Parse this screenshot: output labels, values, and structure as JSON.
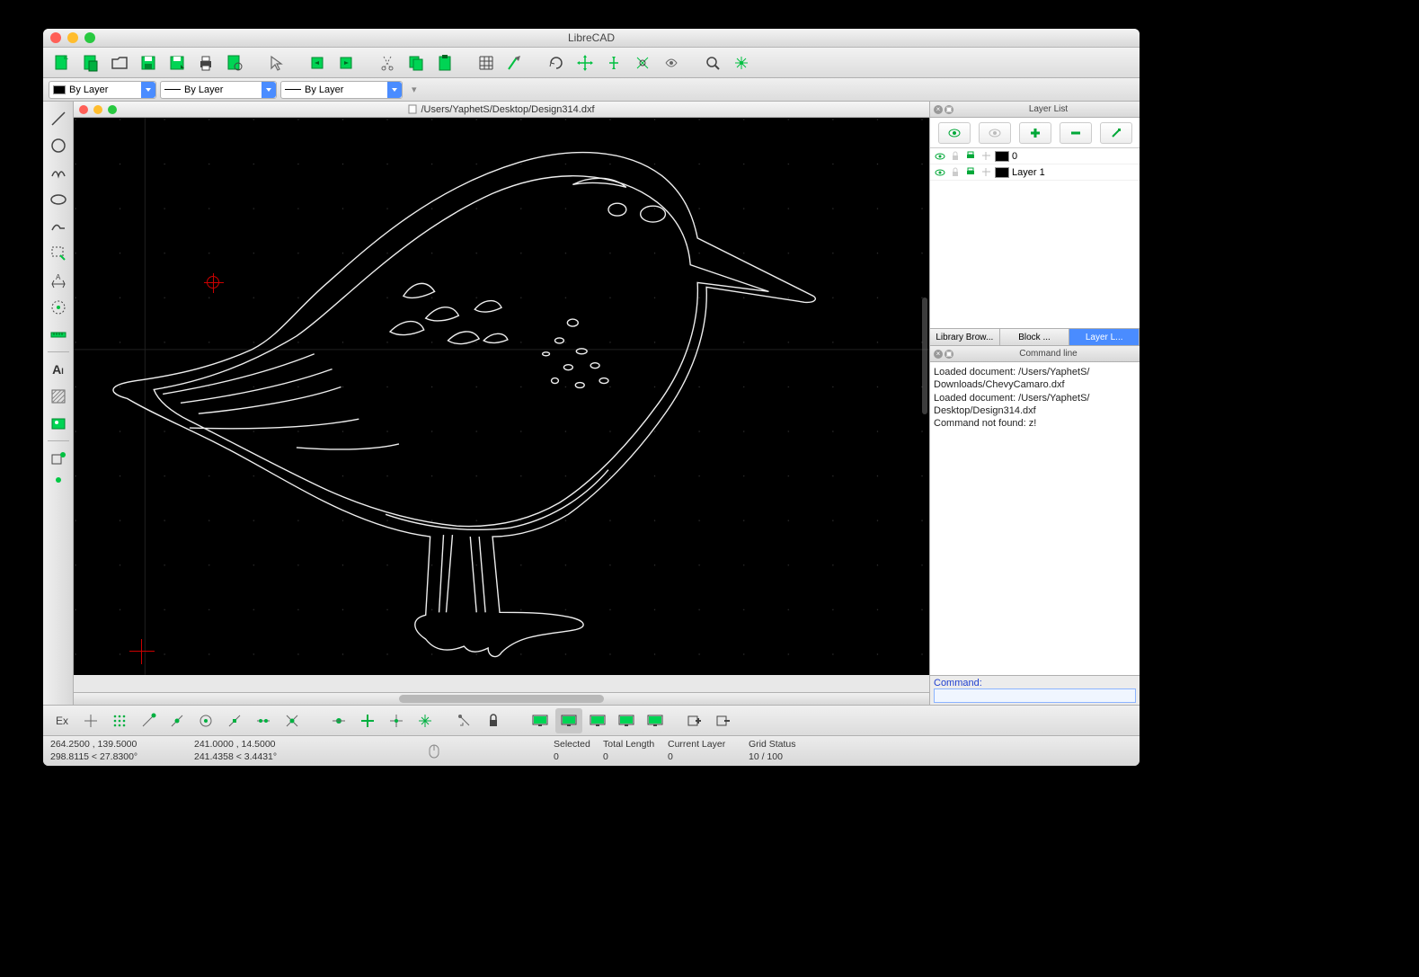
{
  "window": {
    "title": "LibreCAD"
  },
  "document": {
    "path": "/Users/YaphetS/Desktop/Design314.dxf"
  },
  "selectors": {
    "color": "By Layer",
    "width": "By Layer",
    "linetype": "By Layer"
  },
  "layerPanel": {
    "title": "Layer List",
    "layers": [
      {
        "name": "0"
      },
      {
        "name": "Layer 1"
      }
    ]
  },
  "tabs": {
    "library": "Library Brow...",
    "block": "Block ...",
    "layer": "Layer L..."
  },
  "commandLine": {
    "title": "Command line",
    "log": "Loaded document: /Users/YaphetS/\nDownloads/ChevyCamaro.dxf\nLoaded document: /Users/YaphetS/\nDesktop/Design314.dxf\nCommand not found: z!",
    "prompt": "Command:"
  },
  "status": {
    "abs": "264.2500 , 139.5000",
    "polar": "298.8115 < 27.8300°",
    "rel": "241.0000 , 14.5000",
    "relPolar": "241.4358 < 3.4431°",
    "selected_label": "Selected",
    "selected_value": "0",
    "total_len_label": "Total Length",
    "total_len_value": "0",
    "current_layer_label": "Current Layer",
    "current_layer_value": "0",
    "grid_label": "Grid Status",
    "grid_value": "10 / 100"
  },
  "bottom": {
    "ex": "Ex"
  }
}
